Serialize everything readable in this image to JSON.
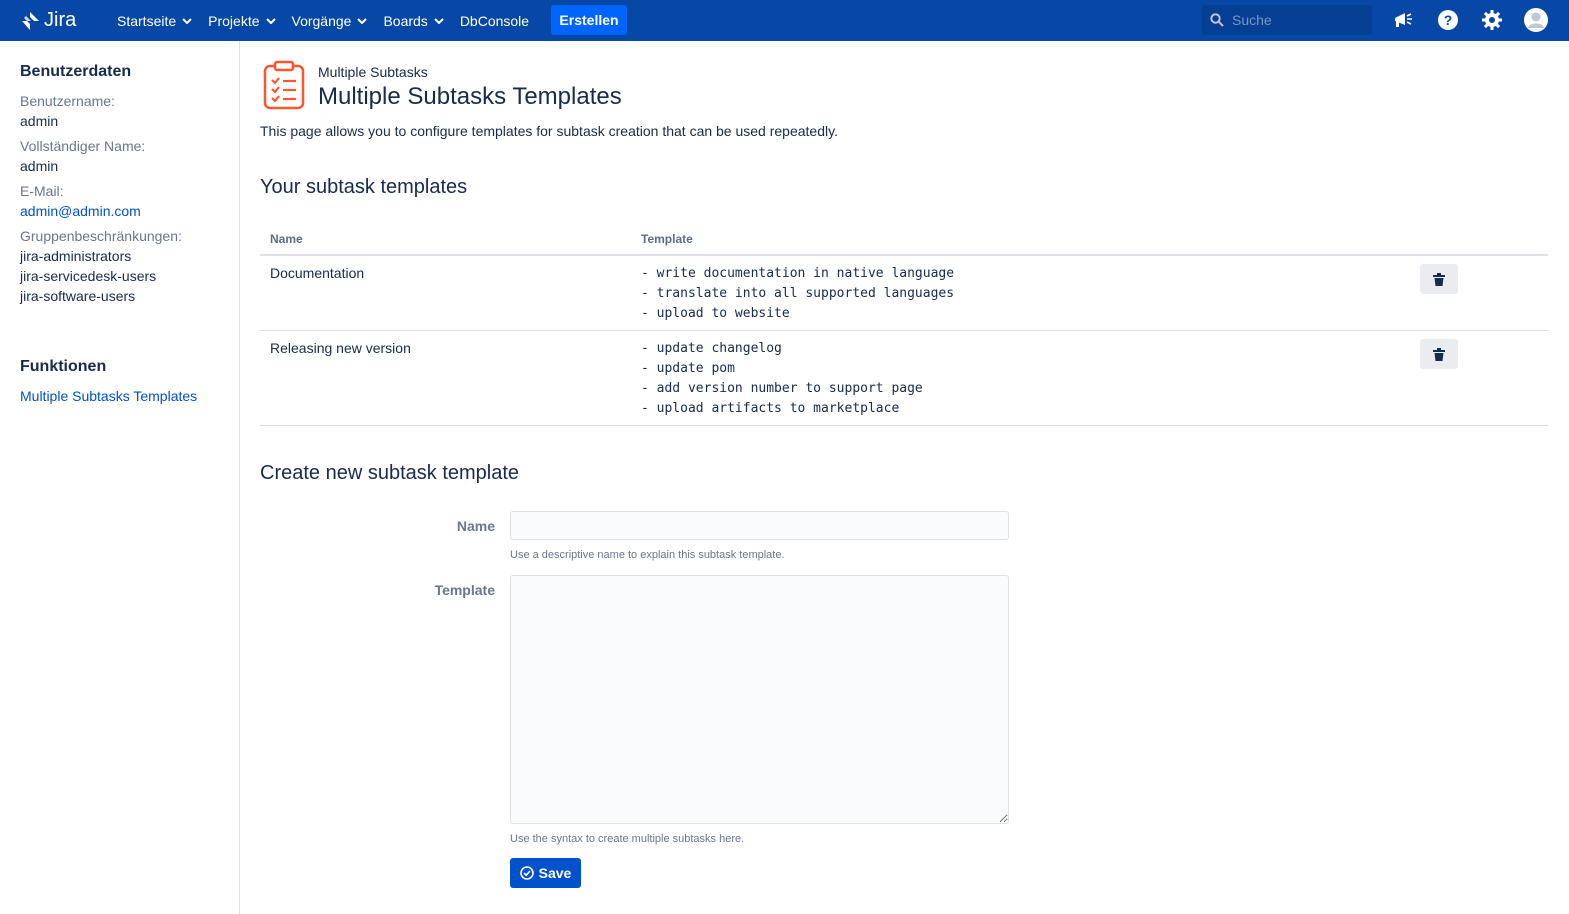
{
  "nav": {
    "logo_text": "Jira",
    "items": [
      {
        "label": "Startseite",
        "has_dropdown": true
      },
      {
        "label": "Projekte",
        "has_dropdown": true
      },
      {
        "label": "Vorgänge",
        "has_dropdown": true
      },
      {
        "label": "Boards",
        "has_dropdown": true
      },
      {
        "label": "DbConsole",
        "has_dropdown": false
      }
    ],
    "create_label": "Erstellen",
    "search_placeholder": "Suche",
    "icons": [
      "megaphone-icon",
      "help-icon",
      "settings-icon",
      "avatar"
    ],
    "brand_color": "#0747a6",
    "create_color": "#0065ff"
  },
  "sidebar": {
    "user_heading": "Benutzerdaten",
    "username_label": "Benutzername:",
    "username_value": "admin",
    "fullname_label": "Vollständiger Name:",
    "fullname_value": "admin",
    "email_label": "E-Mail:",
    "email_value": "admin@admin.com",
    "groups_label": "Gruppenbeschränkungen:",
    "groups": [
      "jira-administrators",
      "jira-servicedesk-users",
      "jira-software-users"
    ],
    "functions_heading": "Funktionen",
    "functions_link": "Multiple Subtasks Templates"
  },
  "main": {
    "breadcrumb": "Multiple Subtasks",
    "title": "Multiple Subtasks Templates",
    "description": "This page allows you to configure templates for subtask creation that can be used repeatedly.",
    "templates_heading": "Your subtask templates",
    "table": {
      "col_name": "Name",
      "col_template": "Template",
      "rows": [
        {
          "name": "Documentation",
          "lines": [
            "- write documentation in native language",
            "- translate into all supported languages",
            "- upload to website"
          ]
        },
        {
          "name": "Releasing new version",
          "lines": [
            "- update changelog",
            "- update pom",
            "- add version number to support page",
            "- upload artifacts to marketplace"
          ]
        }
      ]
    },
    "create_heading": "Create new subtask template",
    "form": {
      "name_label": "Name",
      "name_value": "",
      "name_hint": "Use a descriptive name to explain this subtask template.",
      "template_label": "Template",
      "template_value": "",
      "template_hint": "Use the syntax to create multiple subtasks here.",
      "save_label": "Save"
    }
  }
}
